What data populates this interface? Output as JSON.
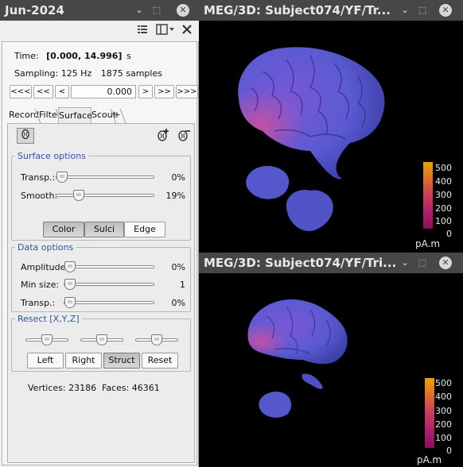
{
  "left_window": {
    "title": "Jun-2024",
    "min_glyph": "⌄",
    "restore_glyph": "⬚",
    "close_glyph": "✕"
  },
  "toolbar": {
    "list_icon": "list-icon",
    "layout_icon": "layout-icon",
    "close_icon": "close-icon"
  },
  "time": {
    "label": "Time:",
    "value": "[0.000, 14.996]",
    "unit": "s",
    "sampling_label": "Sampling: 125 Hz",
    "samples": "1875 samples",
    "nav_first": "<<<",
    "nav_prev_big": "<<",
    "nav_prev": "<",
    "current": "0.000",
    "nav_next": ">",
    "nav_next_big": ">>",
    "nav_last": ">>>"
  },
  "tabs": [
    {
      "label": "Record",
      "active": false
    },
    {
      "label": "Filter",
      "active": false
    },
    {
      "label": "Surface",
      "active": true
    },
    {
      "label": "Scout",
      "active": false
    },
    {
      "label": "+",
      "active": false
    }
  ],
  "surface_options": {
    "legend": "Surface options",
    "transp_label": "Transp.:",
    "transp_value": "0%",
    "transp_level": 0.0,
    "smooth_label": "Smooth:",
    "smooth_value": "19%",
    "smooth_level": 0.19,
    "btn_color": "Color",
    "btn_sulci": "Sulci",
    "btn_edge": "Edge"
  },
  "data_options": {
    "legend": "Data options",
    "amplitude_label": "Amplitude:",
    "amplitude_value": "0%",
    "amplitude_level": 0.0,
    "minsize_label": "Min size:",
    "minsize_value": "1",
    "minsize_level": 0.0,
    "transp_label": "Transp.:",
    "transp_value": "0%",
    "transp_level": 0.0
  },
  "resect": {
    "legend": "Resect [X,Y,Z]",
    "x_level": 0.5,
    "y_level": 0.5,
    "z_level": 0.5,
    "btn_left": "Left",
    "btn_right": "Right",
    "btn_struct": "Struct",
    "btn_reset": "Reset"
  },
  "stats": {
    "vertices": "Vertices: 23186",
    "faces": "Faces: 46361"
  },
  "figure_top": {
    "title": "MEG/3D: Subject074/YF/Tr...",
    "colorbar_ticks": [
      "500",
      "400",
      "300",
      "200",
      "100",
      "0"
    ],
    "unit": "pA.m"
  },
  "figure_bottom": {
    "title": "MEG/3D: Subject074/YF/Tri...",
    "colorbar_ticks": [
      "500",
      "400",
      "300",
      "200",
      "100",
      "0"
    ],
    "unit": "pA.m"
  },
  "colors": {
    "brain_base": "#5a5ad2",
    "brain_hot": "#d04fa0",
    "colorbar_top": "#e8a400",
    "colorbar_bottom": "#b0206a",
    "legend_blue": "#2d55a8"
  }
}
